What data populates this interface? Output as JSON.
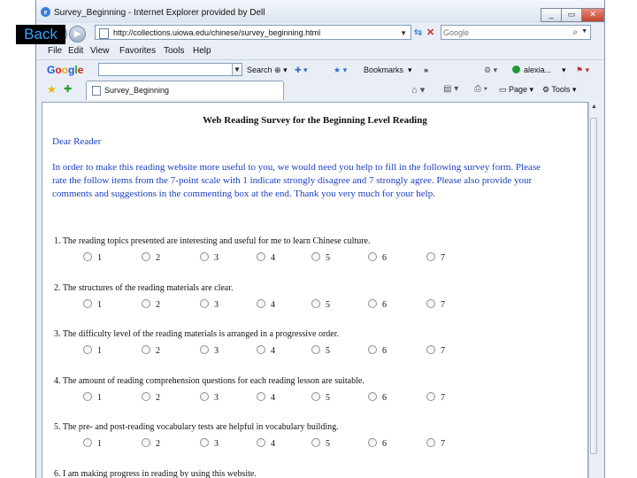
{
  "overlay": {
    "back_label": "Back"
  },
  "window": {
    "title": "Survey_Beginning - Internet Explorer provided by Dell",
    "minimize": "_",
    "maximize": "▭",
    "close": "✕"
  },
  "address": {
    "url": "http://collections.uiowa.edu/chinese/survey_beginning.html",
    "search_placeholder": "Google"
  },
  "menu": [
    "File",
    "Edit",
    "View",
    "Favorites",
    "Tools",
    "Help"
  ],
  "google_toolbar": {
    "logo": "Google",
    "logo_colors": [
      "#1a5cd8",
      "#d6241f",
      "#f1a90c",
      "#1a5cd8",
      "#2b9a2d",
      "#d6241f"
    ],
    "search_label": "Search",
    "bookmarks_label": "Bookmarks",
    "more": "»",
    "user": "alexia...",
    "status_color": "#1f9a2e"
  },
  "tab": {
    "label": "Survey_Beginning",
    "page_label": "Page",
    "tools_label": "Tools"
  },
  "page": {
    "title": "Web Reading Survey for the Beginning Level Reading",
    "salutation": "Dear Reader",
    "intro": "In order to make this reading website more useful to you, we would need you help to fill in the following survey form. Please rate the follow items from the 7-point scale with 1 indicate strongly disagree and 7 strongly agree. Please also provide your comments and suggestions in the commenting box at the end. Thank you very much for your help.",
    "scale": [
      "1",
      "2",
      "3",
      "4",
      "5",
      "6",
      "7"
    ],
    "questions": [
      "1. The reading topics presented are interesting and useful for me to learn Chinese culture.",
      "2. The structures of the reading materials are clear.",
      "3. The difficulty level of the reading materials is arranged in a progressive order.",
      "4. The amount of reading comprehension questions for each reading lesson are suitable.",
      "5. The pre- and post-reading vocabulary tests are helpful in vocabulary building.",
      "6. I am making progress in reading by using this website."
    ]
  },
  "colors": {
    "link_blue": "#1a3fbf",
    "window_frame": "#e9eef6",
    "back_text": "#3da0ff"
  }
}
